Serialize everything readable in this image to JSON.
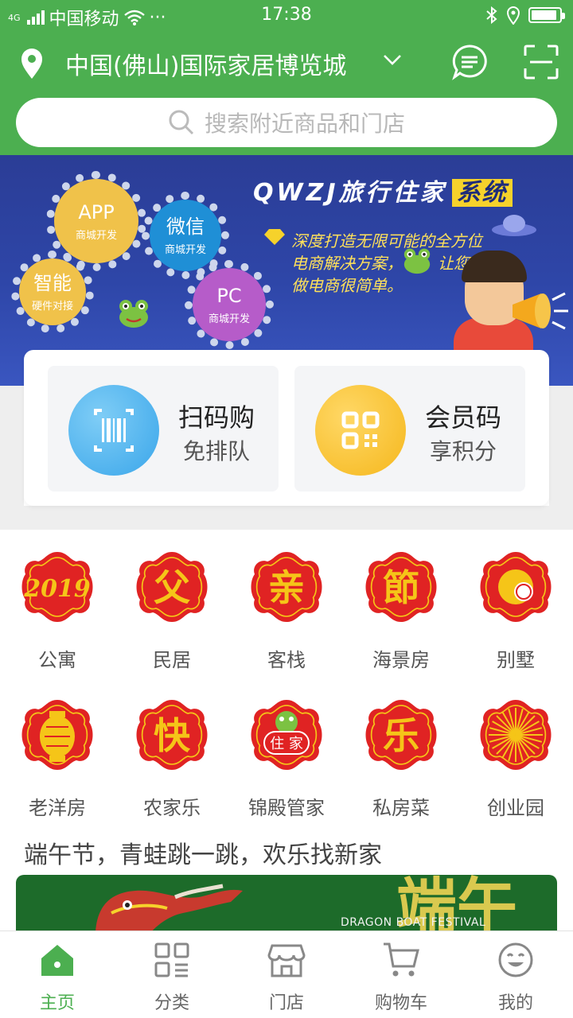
{
  "status_bar": {
    "network": "4G",
    "carrier": "中国移动",
    "more": "···",
    "time": "17:38",
    "battery_level": 0.9
  },
  "header": {
    "location": "中国(佛山)国际家居博览城",
    "search_placeholder": "搜索附近商品和门店"
  },
  "banner": {
    "title": "QWZJ旅行住家",
    "title_highlight": "系统",
    "tagline_lines": [
      "深度打造无限可能的全方位",
      "电商解决方案，",
      "让您",
      "做电商很简单。"
    ],
    "gears": [
      {
        "big": "APP",
        "small": "商城开发",
        "color": "#f0c24a"
      },
      {
        "big": "微信",
        "small": "商城开发",
        "color": "#1f8fd6"
      },
      {
        "big": "智能",
        "small": "硬件对接",
        "color": "#f0c24a"
      },
      {
        "big": "PC",
        "small": "商城开发",
        "color": "#b65cc9"
      }
    ]
  },
  "quick_actions": [
    {
      "title": "扫码购",
      "subtitle": "免排队",
      "icon": "barcode-scan-icon",
      "color": "#3aa6ea"
    },
    {
      "title": "会员码",
      "subtitle": "享积分",
      "icon": "qr-code-icon",
      "color": "#f5b71c"
    }
  ],
  "categories": [
    {
      "label": "公寓",
      "glyph": "2019",
      "icon": "paper-cut-2019-icon"
    },
    {
      "label": "民居",
      "glyph": "父",
      "icon": "paper-cut-fu-icon"
    },
    {
      "label": "客栈",
      "glyph": "亲",
      "icon": "paper-cut-qin-icon"
    },
    {
      "label": "海景房",
      "glyph": "節",
      "icon": "paper-cut-jie-icon"
    },
    {
      "label": "别墅",
      "glyph": "",
      "icon": "paper-cut-dog-icon"
    },
    {
      "label": "老洋房",
      "glyph": "",
      "icon": "paper-cut-lantern-icon"
    },
    {
      "label": "农家乐",
      "glyph": "快",
      "icon": "paper-cut-kuai-icon"
    },
    {
      "label": "锦殿管家",
      "glyph": "住家",
      "icon": "paper-cut-frog-icon"
    },
    {
      "label": "私房菜",
      "glyph": "乐",
      "icon": "paper-cut-le-icon"
    },
    {
      "label": "创业园",
      "glyph": "",
      "icon": "paper-cut-firework-icon"
    }
  ],
  "section_title": "端午节，青蛙跳一跳，欢乐找新家",
  "promo_banner": {
    "big_text": "端午",
    "english": "DRAGON BOAT FESTIVAL"
  },
  "tabbar": [
    {
      "label": "主页",
      "icon": "home-icon",
      "active": true
    },
    {
      "label": "分类",
      "icon": "grid-list-icon",
      "active": false
    },
    {
      "label": "门店",
      "icon": "store-icon",
      "active": false
    },
    {
      "label": "购物车",
      "icon": "cart-icon",
      "active": false
    },
    {
      "label": "我的",
      "icon": "smiley-icon",
      "active": false
    }
  ],
  "colors": {
    "brand_green": "#4caf50",
    "paper_cut_red": "#e02323",
    "paper_cut_gold": "#f5c518"
  }
}
